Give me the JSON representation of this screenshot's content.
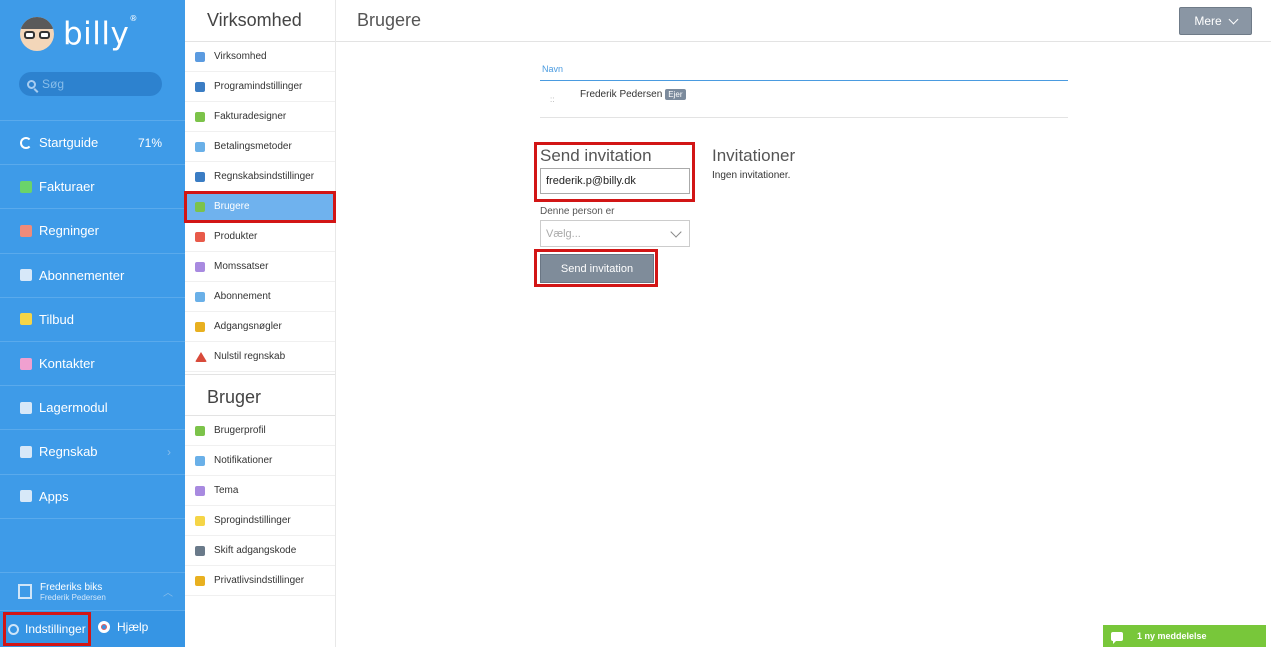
{
  "brand": {
    "name": "billy"
  },
  "search": {
    "placeholder": "Søg"
  },
  "nav": {
    "items": [
      {
        "label": "Startguide",
        "extra": "71%",
        "icon": "progress-icon",
        "color": "#ffffff"
      },
      {
        "label": "Fakturaer",
        "icon": "invoice-icon",
        "color": "#6ad36a"
      },
      {
        "label": "Regninger",
        "icon": "bill-icon",
        "color": "#ef8b7a"
      },
      {
        "label": "Abonnementer",
        "icon": "subscription-icon",
        "color": "#d7e8f8"
      },
      {
        "label": "Tilbud",
        "icon": "star-icon",
        "color": "#f5d547"
      },
      {
        "label": "Kontakter",
        "icon": "contact-icon",
        "color": "#f0a0d0"
      },
      {
        "label": "Lagermodul",
        "icon": "inventory-icon",
        "color": "#d7e8f8"
      },
      {
        "label": "Regnskab",
        "icon": "ledger-icon",
        "color": "#d7e8f8"
      },
      {
        "label": "Apps",
        "icon": "apps-icon",
        "color": "#d7e8f8"
      }
    ]
  },
  "company": {
    "name": "Frederiks biks",
    "user": "Frederik Pedersen"
  },
  "bottom": {
    "settings": "Indstillinger",
    "help": "Hjælp"
  },
  "subnav": {
    "company_title": "Virksomhed",
    "company_items": [
      {
        "label": "Virksomhed",
        "icon": "building-icon",
        "color": "#5b9be0"
      },
      {
        "label": "Programindstillinger",
        "icon": "gear-icon",
        "color": "#3b7dc4"
      },
      {
        "label": "Fakturadesigner",
        "icon": "design-icon",
        "color": "#7cc34a"
      },
      {
        "label": "Betalingsmetoder",
        "icon": "card-icon",
        "color": "#6ab0e8"
      },
      {
        "label": "Regnskabsindstillinger",
        "icon": "ledger-icon",
        "color": "#3b7dc4"
      },
      {
        "label": "Brugere",
        "icon": "users-icon",
        "color": "#7cc34a"
      },
      {
        "label": "Produkter",
        "icon": "product-icon",
        "color": "#e85a4a"
      },
      {
        "label": "Momssatser",
        "icon": "pie-icon",
        "color": "#a88ae0"
      },
      {
        "label": "Abonnement",
        "icon": "subscription-icon",
        "color": "#6ab0e8"
      },
      {
        "label": "Adgangsnøgler",
        "icon": "key-icon",
        "color": "#e8b020"
      },
      {
        "label": "Nulstil regnskab",
        "icon": "warning-icon",
        "color": "#d84a3a"
      }
    ],
    "user_title": "Bruger",
    "user_items": [
      {
        "label": "Brugerprofil",
        "icon": "profile-icon",
        "color": "#7cc34a"
      },
      {
        "label": "Notifikationer",
        "icon": "bell-icon",
        "color": "#6ab0e8"
      },
      {
        "label": "Tema",
        "icon": "theme-icon",
        "color": "#a88ae0"
      },
      {
        "label": "Sprogindstillinger",
        "icon": "speech-icon",
        "color": "#f5d547"
      },
      {
        "label": "Skift adgangskode",
        "icon": "lock-icon",
        "color": "#6a7a8a"
      },
      {
        "label": "Privatlivsindstillinger",
        "icon": "privacy-icon",
        "color": "#e8b020"
      }
    ]
  },
  "main": {
    "title": "Brugere",
    "more": "Mere",
    "table": {
      "column": "Navn",
      "rows": [
        {
          "avatar": "::",
          "name": "Frederik Pedersen",
          "badge": "Ejer"
        }
      ]
    },
    "invite": {
      "title": "Send invitation",
      "email_value": "frederik.p@billy.dk",
      "role_label": "Denne person er",
      "role_placeholder": "Vælg...",
      "send_label": "Send invitation"
    },
    "invitations": {
      "title": "Invitationer",
      "empty": "Ingen invitationer."
    }
  },
  "chat": {
    "label": "1 ny meddelelse"
  },
  "colors": {
    "sidebar": "#3e9be8",
    "highlight": "#d21515",
    "chat": "#78c73a",
    "active_sub": "#6fb2ee"
  }
}
